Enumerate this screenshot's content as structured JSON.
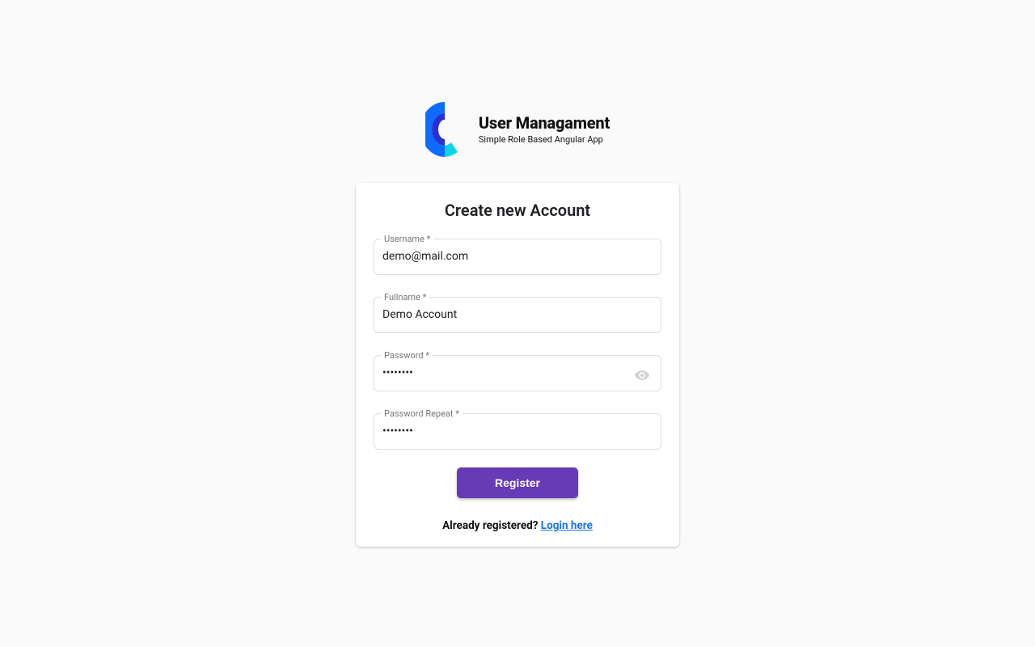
{
  "brand": {
    "title": "User Managament",
    "subtitle": "Simple Role Based Angular App"
  },
  "card": {
    "title": "Create new Account"
  },
  "fields": {
    "username": {
      "label": "Username *",
      "value": "demo@mail.com"
    },
    "fullname": {
      "label": "Fullname *",
      "value": "Demo Account"
    },
    "password": {
      "label": "Password *",
      "value": "••••••••"
    },
    "password_repeat": {
      "label": "Password Repeat *",
      "value": "••••••••"
    }
  },
  "buttons": {
    "register": "Register"
  },
  "footer": {
    "prompt": "Already registered? ",
    "link": "Login here"
  },
  "colors": {
    "accent": "#673ab7",
    "link": "#1a73e8"
  }
}
